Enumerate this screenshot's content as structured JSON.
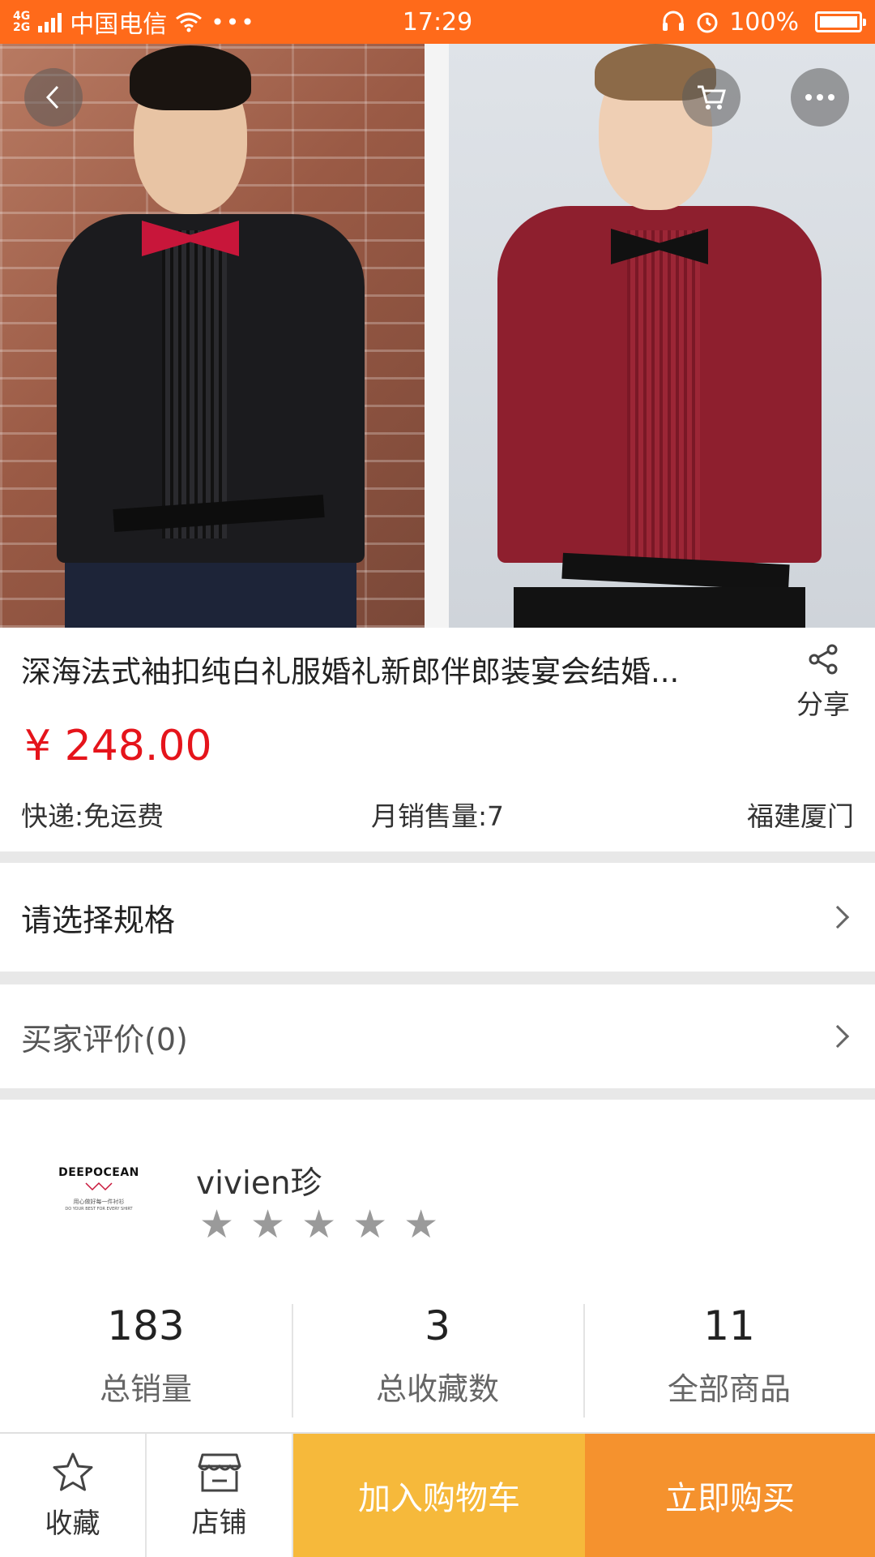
{
  "status_bar": {
    "network": [
      "4G",
      "2G"
    ],
    "carrier": "中国电信",
    "time": "17:29",
    "battery": "100%"
  },
  "product": {
    "title": "深海法式袖扣纯白礼服婚礼新郎伴郎装宴会结婚...",
    "price": "¥ 248.00",
    "shipping": "快递:免运费",
    "monthly_sales": "月销售量:7",
    "location": "福建厦门",
    "share_label": "分享"
  },
  "rows": {
    "spec": "请选择规格",
    "reviews": "买家评价(0)"
  },
  "shop": {
    "logo_main": "DEEPOCEAN",
    "logo_sub": "用心做好每一件衬衫",
    "logo_tag": "DO YOUR BEST FOR EVERY SHIRT",
    "name": "vivien珍",
    "stars": [
      "★",
      "★",
      "★",
      "★",
      "★"
    ],
    "stats": [
      {
        "value": "183",
        "label": "总销量"
      },
      {
        "value": "3",
        "label": "总收藏数"
      },
      {
        "value": "11",
        "label": "全部商品"
      }
    ]
  },
  "bottom_bar": {
    "favorite": "收藏",
    "store": "店铺",
    "add_to_cart": "加入购物车",
    "buy_now": "立即购买"
  },
  "colors": {
    "status_bar": "#ff6a1a",
    "price": "#e5141b",
    "cart_button": "#f6b93b",
    "buy_button": "#f5922e"
  }
}
